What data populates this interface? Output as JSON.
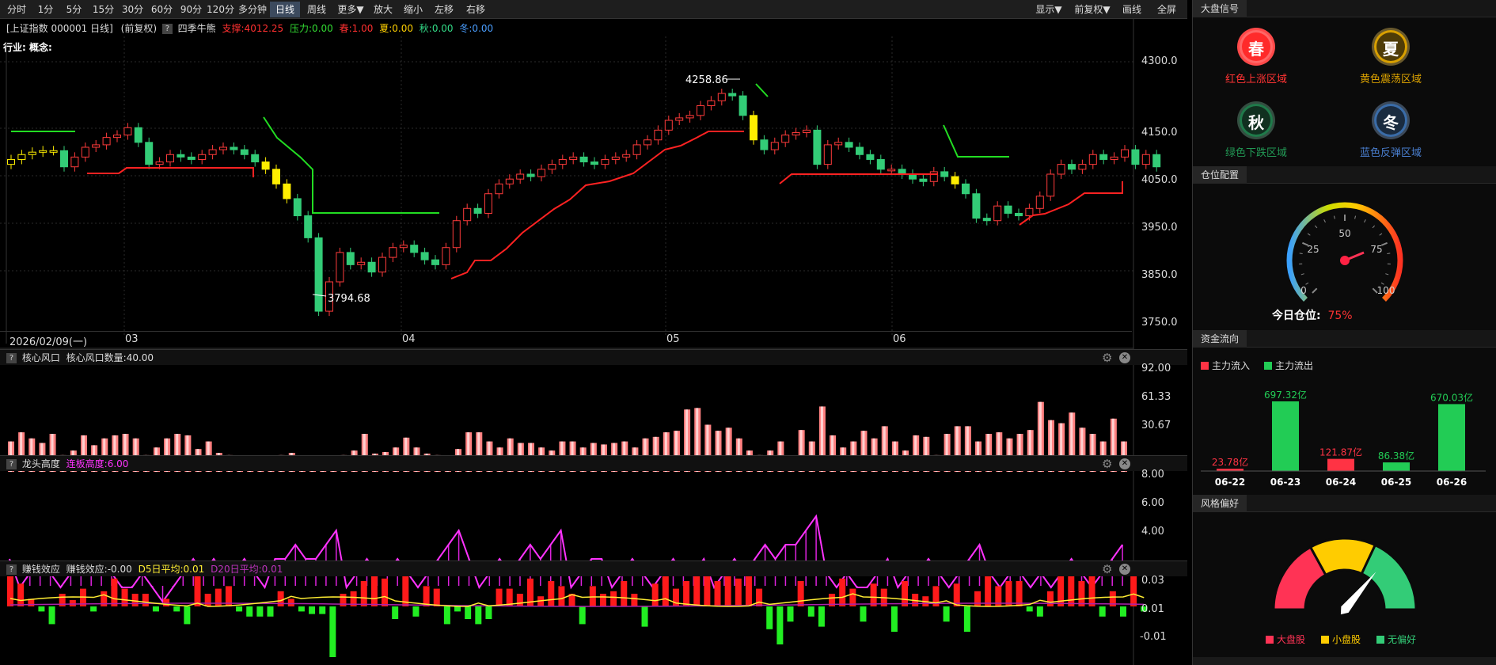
{
  "toolbar": {
    "periods": [
      "分时",
      "1分",
      "5分",
      "15分",
      "30分",
      "60分",
      "90分",
      "120分",
      "多分钟",
      "日线",
      "周线",
      "更多▼",
      "放大",
      "缩小",
      "左移",
      "右移"
    ],
    "right": [
      "显示▼",
      "前复权▼",
      "画线",
      "全屏"
    ]
  },
  "info": {
    "title": "[上证指数 000001 日线]",
    "adjust": "(前复权)",
    "indicator": "四季牛熊",
    "support": "支撑:4012.25",
    "pressure": "压力:0.00",
    "spring": "春:1.00",
    "summer": "夏:0.00",
    "autumn": "秋:0.00",
    "winter": "冬:0.00",
    "industry": "行业: 概念:"
  },
  "main": {
    "y_ticks": [
      "4300.0",
      "4150.0",
      "4050.0",
      "3950.0",
      "3850.0",
      "3750.0"
    ],
    "high_label": "4258.86",
    "low_label": "3794.68",
    "date_label": "2026/02/09(一)",
    "months": [
      "03",
      "04",
      "05",
      "06"
    ]
  },
  "p1": {
    "name": "核心风口",
    "value": "核心风口数量:40.00",
    "ticks": [
      "92.00",
      "61.33",
      "30.67"
    ]
  },
  "p2": {
    "name": "龙头高度",
    "value": "连板高度:6.00",
    "ticks": [
      "8.00",
      "6.00",
      "4.00"
    ]
  },
  "p3": {
    "name": "赚钱效应",
    "value": "赚钱效应:-0.00",
    "d5": "D5日平均:0.01",
    "d20": "D20日平均:0.01",
    "ticks": [
      "0.03",
      "0.01",
      "-0.01"
    ]
  },
  "side": {
    "signal_title": "大盘信号",
    "seasons": [
      {
        "icon": "春",
        "label": "红色上涨区域",
        "color": "#ff2a2a",
        "active": true
      },
      {
        "icon": "夏",
        "label": "黄色震荡区域",
        "color": "#d9a000",
        "active": false
      },
      {
        "icon": "秋",
        "label": "绿色下跌区域",
        "color": "#1f7a4a",
        "active": false
      },
      {
        "icon": "冬",
        "label": "蓝色反弹区域",
        "color": "#3a6ca8",
        "active": false
      }
    ],
    "position_title": "仓位配置",
    "gauge_ticks": [
      "0",
      "25",
      "50",
      "75",
      "100"
    ],
    "position_label": "今日仓位:",
    "position_value": "75%",
    "position_pct": 75,
    "flow_title": "资金流向",
    "flow_in": "主力流入",
    "flow_out": "主力流出",
    "flow": [
      {
        "date": "06-22",
        "label": "23.78亿",
        "value": 23.78,
        "dir": "in"
      },
      {
        "date": "06-23",
        "label": "697.32亿",
        "value": 697.32,
        "dir": "out"
      },
      {
        "date": "06-24",
        "label": "121.87亿",
        "value": 121.87,
        "dir": "in"
      },
      {
        "date": "06-25",
        "label": "86.38亿",
        "value": 86.38,
        "dir": "out"
      },
      {
        "date": "06-26",
        "label": "670.03亿",
        "value": 670.03,
        "dir": "out"
      }
    ],
    "style_title": "风格偏好",
    "style_legend": [
      "大盘股",
      "小盘股",
      "无偏好"
    ]
  }
}
